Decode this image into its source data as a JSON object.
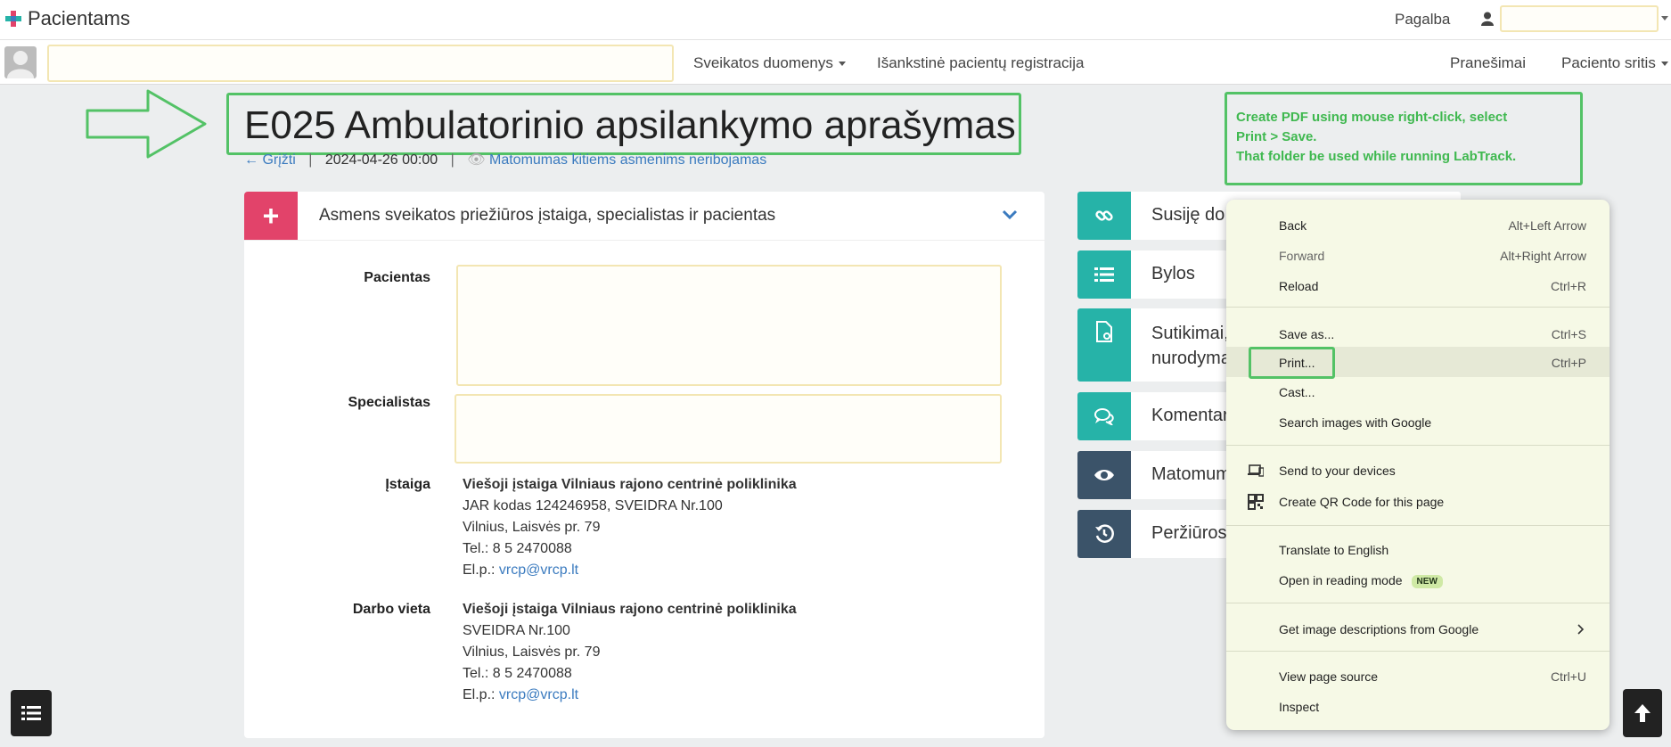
{
  "app": {
    "title": "Pacientams",
    "help": "Pagalba"
  },
  "nav": {
    "health_data": "Sveikatos duomenys",
    "registration": "Išankstinė pacientų registracija",
    "messages": "Pranešimai",
    "patient_area": "Paciento sritis"
  },
  "page": {
    "title": "E025 Ambulatorinio apsilankymo aprašymas",
    "back": "← Grįžti",
    "date": "2024-04-26 00:00",
    "visibility": "Matomumas kitiems asmenims neribojamas"
  },
  "annotation": {
    "note_line1": "Create PDF using mouse right-click,  select",
    "note_line2": "Print > Save.",
    "note_line3": "That folder be used while running LabTrack."
  },
  "panel": {
    "title": "Asmens sveikatos priežiūros įstaiga, specialistas ir pacientas",
    "patient_label": "Pacientas",
    "specialist_label": "Specialistas",
    "institution_label": "Įstaiga",
    "institution": {
      "name": "Viešoji įstaiga Vilniaus rajono centrinė poliklinika",
      "code": "JAR kodas 124246958, SVEIDRA Nr.100",
      "address": "Vilnius, Laisvės pr. 79",
      "phone": "Tel.: 8 5 2470088",
      "email_label": "El.p.:",
      "email": "vrcp@vrcp.lt"
    },
    "workplace_label": "Darbo vieta",
    "workplace": {
      "name": "Viešoji įstaiga Vilniaus rajono centrinė poliklinika",
      "code": "SVEIDRA Nr.100",
      "address": "Vilnius, Laisvės pr. 79",
      "phone": "Tel.: 8 5 2470088",
      "email_label": "El.p.:",
      "email": "vrcp@vrcp.lt"
    }
  },
  "sidebar": {
    "related": "Susiję do",
    "files": "Bylos",
    "consents_1": "Sutikimai,",
    "consents_2": "nurodyma",
    "comments": "Komentar",
    "visibility": "Matomum",
    "views": "Peržiūros"
  },
  "context_menu": {
    "back": "Back",
    "back_sc": "Alt+Left Arrow",
    "forward": "Forward",
    "forward_sc": "Alt+Right Arrow",
    "reload": "Reload",
    "reload_sc": "Ctrl+R",
    "save_as": "Save as...",
    "save_as_sc": "Ctrl+S",
    "print": "Print...",
    "print_sc": "Ctrl+P",
    "cast": "Cast...",
    "search_images": "Search images with Google",
    "send_devices": "Send to your devices",
    "qr_code": "Create QR Code for this page",
    "translate": "Translate to English",
    "reading_mode": "Open in reading mode",
    "new_badge": "NEW",
    "image_desc": "Get image descriptions from Google",
    "view_source": "View page source",
    "view_source_sc": "Ctrl+U",
    "inspect": "Inspect"
  },
  "colors": {
    "accent_pink": "#e2436a",
    "teal": "#26b3a8",
    "slate": "#3b5369",
    "annotation_green": "#53c266",
    "link": "#3b7bbf"
  }
}
